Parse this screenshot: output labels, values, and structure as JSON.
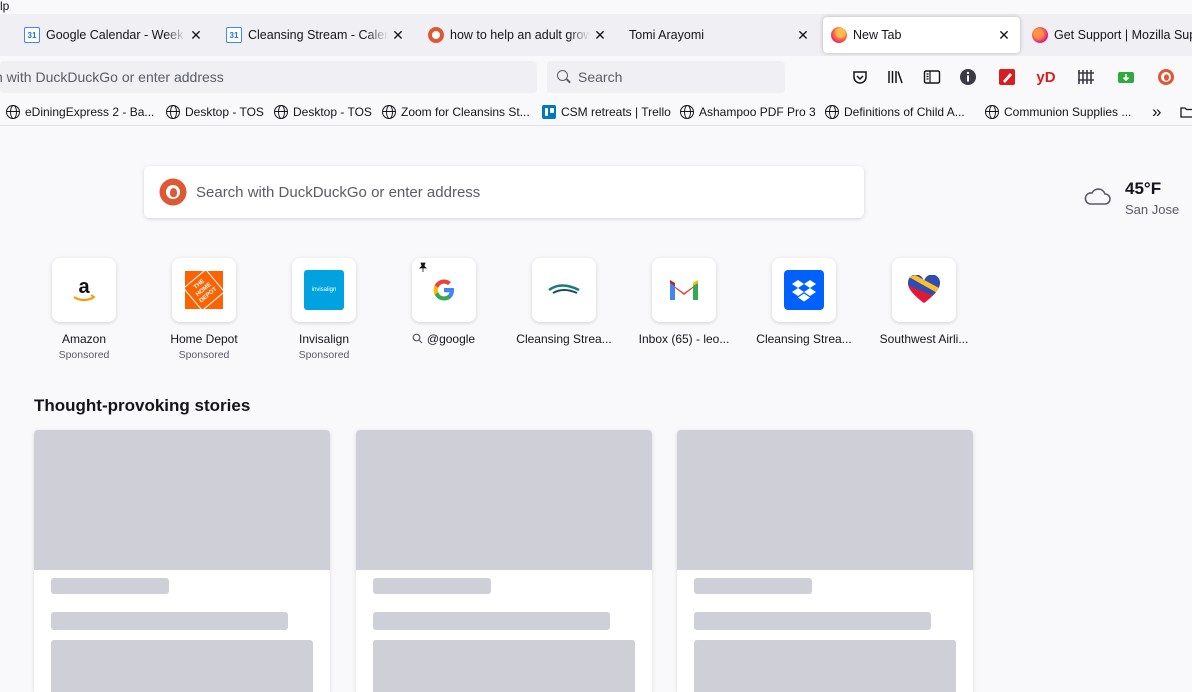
{
  "menu_remnant": "lp",
  "tabs": [
    {
      "title": "Google Calendar - Week of",
      "favicon": "calendar-icon"
    },
    {
      "title": "Cleansing Stream - Calendar",
      "favicon": "calendar-icon"
    },
    {
      "title": "how to help an adult grow",
      "favicon": "duckduckgo-icon"
    },
    {
      "title": "Tomi Arayomi",
      "favicon": ""
    },
    {
      "title": "New Tab",
      "favicon": "firefox-icon",
      "active": true
    },
    {
      "title": "Get Support | Mozilla Supp",
      "favicon": "mozilla-icon"
    }
  ],
  "close_glyph": "✕",
  "calendar_glyph": "31",
  "urlbar": {
    "text": "ch with DuckDuckGo or enter address"
  },
  "searchbar": {
    "placeholder": "Search"
  },
  "toolbar_icons": [
    "pocket-icon",
    "library-icon",
    "sidebar-icon",
    "info-icon",
    "highlighter-icon",
    "yandex-icon",
    "grid-extension-icon",
    "download-extension-icon",
    "duckduckgo-icon"
  ],
  "toolbar_labels": {
    "yandex": "yD"
  },
  "bookmarks": [
    {
      "label": "eDiningExpress 2 - Ba..."
    },
    {
      "label": "Desktop - TOS"
    },
    {
      "label": "Desktop - TOS"
    },
    {
      "label": "Zoom for Cleansins St..."
    },
    {
      "label": "CSM retreats | Trello"
    },
    {
      "label": "Ashampoo PDF Pro 3"
    },
    {
      "label": "Definitions of Child A..."
    },
    {
      "label": "Communion Supplies ..."
    }
  ],
  "bookmarks_overflow": "»",
  "main_search": {
    "placeholder": "Search with DuckDuckGo or enter address"
  },
  "weather": {
    "temperature": "45°F",
    "city": "San Jose"
  },
  "top_sites": [
    {
      "label": "Amazon",
      "sponsored": "Sponsored",
      "icon": "amazon-icon"
    },
    {
      "label": "Home Depot",
      "sponsored": "Sponsored",
      "icon": "home-depot-icon"
    },
    {
      "label": "Invisalign",
      "sponsored": "Sponsored",
      "icon": "invisalign-icon"
    },
    {
      "label": "@google",
      "sponsored": "",
      "icon": "google-icon",
      "pinned": true
    },
    {
      "label": "Cleansing Strea...",
      "sponsored": "",
      "icon": "cleansing-stream-icon"
    },
    {
      "label": "Inbox (65) - leo...",
      "sponsored": "",
      "icon": "gmail-icon"
    },
    {
      "label": "Cleansing Strea...",
      "sponsored": "",
      "icon": "dropbox-icon"
    },
    {
      "label": "Southwest Airli...",
      "sponsored": "",
      "icon": "southwest-icon"
    }
  ],
  "tile_text": {
    "home_depot": "THE HOME DEPOT",
    "invisalign": "invisalign",
    "google": "G"
  },
  "stories": {
    "heading": "Thought-provoking stories",
    "cards": 3
  },
  "colors": {
    "accent": "#0061e0",
    "duckduckgo": "#de5833",
    "placeholder": "#cfcfd8"
  }
}
